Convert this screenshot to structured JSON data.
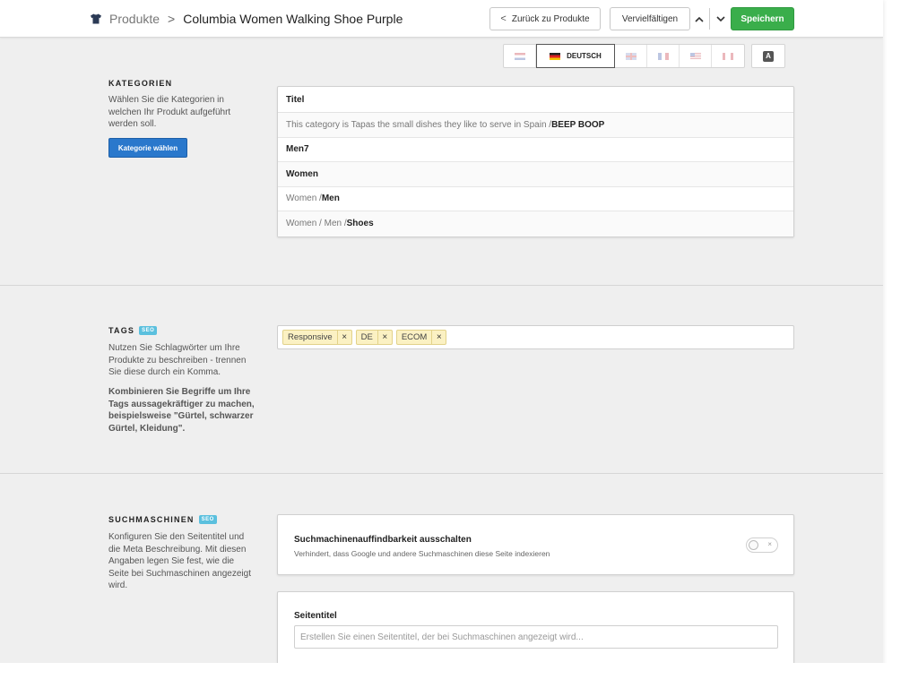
{
  "header": {
    "breadcrumb_parent": "Produkte",
    "breadcrumb_separator": ">",
    "product_title": "Columbia Women Walking Shoe Purple",
    "back_label": "Zurück zu Produkte",
    "back_chevron": "<",
    "duplicate_label": "Vervielfältigen",
    "prev_arrow": "⌃",
    "next_arrow": "⌄",
    "save_label": "Speichern",
    "save_color": "#3aae4b"
  },
  "languages": {
    "active_label": "DEUTSCH",
    "flags": [
      "nl-flag-icon",
      "de-flag-icon",
      "gb-flag-icon",
      "fr-flag-icon",
      "us-flag-icon",
      "ca-flag-icon"
    ],
    "translate_glyph": "A"
  },
  "categories": {
    "title": "KATEGORIEN",
    "description": "Wählen Sie die Kategorien in welchen Ihr Produkt aufgeführt werden soll.",
    "button_label": "Kategorie wählen",
    "button_color": "#2a78cc",
    "table_header": "Titel",
    "rows": [
      {
        "path": "This category is Tapas the small dishes they like to serve in Spain / ",
        "name": "BEEP BOOP"
      },
      {
        "path": "",
        "name": "Men7"
      },
      {
        "path": "",
        "name": "Women"
      },
      {
        "path": "Women / ",
        "name": "Men"
      },
      {
        "path": "Women / Men / ",
        "name": "Shoes"
      }
    ]
  },
  "tags": {
    "title": "TAGS",
    "badge": "SEO",
    "description": "Nutzen Sie Schlagwörter um Ihre Produkte zu beschreiben - trennen Sie diese durch ein Komma.",
    "hint": "Kombinieren Sie Begriffe um Ihre Tags aussagekräftiger zu machen, beispielsweise \"Gürtel, schwarzer Gürtel, Kleidung\".",
    "items": [
      "Responsive",
      "DE",
      "ECOM"
    ],
    "remove_glyph": "×"
  },
  "seo": {
    "title": "SUCHMASCHINEN",
    "badge": "SEO",
    "description": "Konfiguren Sie den Seitentitel und die Meta Beschreibung. Mit diesen Angaben legen Sie fest, wie die Seite bei Suchmaschinen angezeigt wird.",
    "toggle_title": "Suchmachinenauffindbarkeit ausschalten",
    "toggle_sub": "Verhindert, dass Google und andere Suchmaschinen diese Seite indexieren",
    "toggle_off_glyph": "×",
    "page_title_label": "Seitentitel",
    "page_title_placeholder": "Erstellen Sie einen Seitentitel, der bei Suchmaschinen angezeigt wird..."
  }
}
